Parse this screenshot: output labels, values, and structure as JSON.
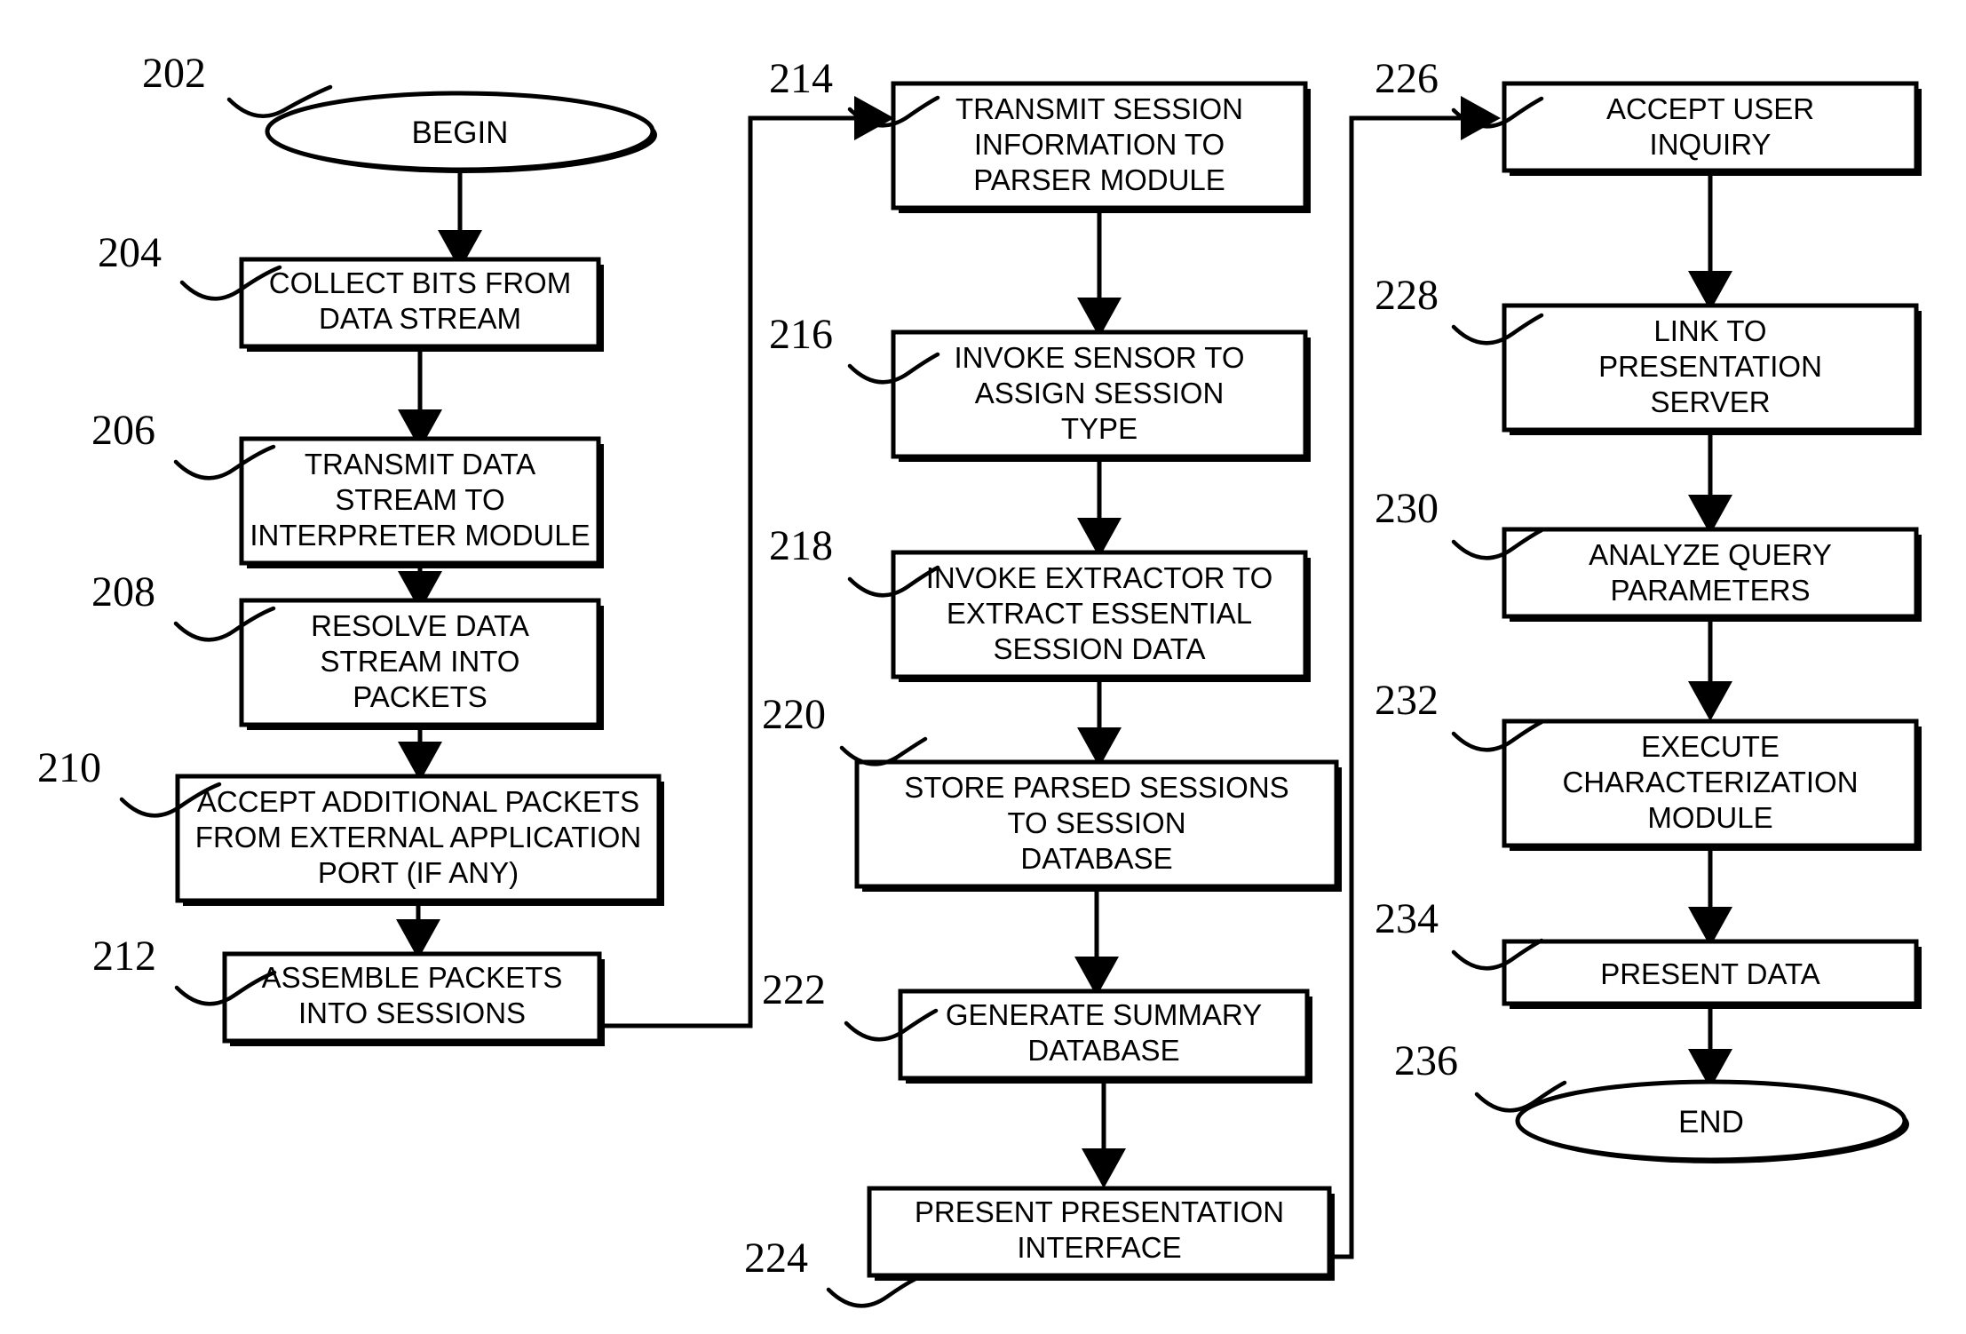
{
  "figure": {
    "type": "patent-flowchart",
    "background": "#ffffff",
    "ink": "#000000"
  },
  "nodes": [
    {
      "ref": "202",
      "shape": "oval",
      "lines": [
        "BEGIN"
      ]
    },
    {
      "ref": "204",
      "shape": "rect",
      "lines": [
        "COLLECT BITS FROM",
        "DATA STREAM"
      ]
    },
    {
      "ref": "206",
      "shape": "rect",
      "lines": [
        "TRANSMIT DATA",
        "STREAM TO",
        "INTERPRETER MODULE"
      ]
    },
    {
      "ref": "208",
      "shape": "rect",
      "lines": [
        "RESOLVE DATA",
        "STREAM INTO",
        "PACKETS"
      ]
    },
    {
      "ref": "210",
      "shape": "rect",
      "lines": [
        "ACCEPT ADDITIONAL PACKETS",
        "FROM EXTERNAL APPLICATION",
        "PORT (IF ANY)"
      ]
    },
    {
      "ref": "212",
      "shape": "rect",
      "lines": [
        "ASSEMBLE PACKETS",
        "INTO SESSIONS"
      ]
    },
    {
      "ref": "214",
      "shape": "rect",
      "lines": [
        "TRANSMIT SESSION",
        "INFORMATION TO",
        "PARSER MODULE"
      ]
    },
    {
      "ref": "216",
      "shape": "rect",
      "lines": [
        "INVOKE SENSOR TO",
        "ASSIGN SESSION",
        "TYPE"
      ]
    },
    {
      "ref": "218",
      "shape": "rect",
      "lines": [
        "INVOKE EXTRACTOR TO",
        "EXTRACT ESSENTIAL",
        "SESSION DATA"
      ]
    },
    {
      "ref": "220",
      "shape": "rect",
      "lines": [
        "STORE PARSED SESSIONS",
        "TO SESSION",
        "DATABASE"
      ]
    },
    {
      "ref": "222",
      "shape": "rect",
      "lines": [
        "GENERATE SUMMARY",
        "DATABASE"
      ]
    },
    {
      "ref": "224",
      "shape": "rect",
      "lines": [
        "PRESENT PRESENTATION",
        "INTERFACE"
      ]
    },
    {
      "ref": "226",
      "shape": "rect",
      "lines": [
        "ACCEPT USER",
        "INQUIRY"
      ]
    },
    {
      "ref": "228",
      "shape": "rect",
      "lines": [
        "LINK TO",
        "PRESENTATION",
        "SERVER"
      ]
    },
    {
      "ref": "230",
      "shape": "rect",
      "lines": [
        "ANALYZE QUERY",
        "PARAMETERS"
      ]
    },
    {
      "ref": "232",
      "shape": "rect",
      "lines": [
        "EXECUTE",
        "CHARACTERIZATION",
        "MODULE"
      ]
    },
    {
      "ref": "234",
      "shape": "rect",
      "lines": [
        "PRESENT DATA"
      ]
    },
    {
      "ref": "236",
      "shape": "oval",
      "lines": [
        "END"
      ]
    }
  ],
  "ref_labels": {
    "n202": "202",
    "n204": "204",
    "n206": "206",
    "n208": "208",
    "n210": "210",
    "n212": "212",
    "n214": "214",
    "n216": "216",
    "n218": "218",
    "n220": "220",
    "n222": "222",
    "n224": "224",
    "n226": "226",
    "n228": "228",
    "n230": "230",
    "n232": "232",
    "n234": "234",
    "n236": "236"
  },
  "labels": {
    "t202_1": "BEGIN",
    "t204_1": "COLLECT BITS FROM",
    "t204_2": "DATA STREAM",
    "t206_1": "TRANSMIT DATA",
    "t206_2": "STREAM TO",
    "t206_3": "INTERPRETER MODULE",
    "t208_1": "RESOLVE DATA",
    "t208_2": "STREAM INTO",
    "t208_3": "PACKETS",
    "t210_1": "ACCEPT ADDITIONAL PACKETS",
    "t210_2": "FROM EXTERNAL APPLICATION",
    "t210_3": "PORT (IF ANY)",
    "t212_1": "ASSEMBLE PACKETS",
    "t212_2": "INTO SESSIONS",
    "t214_1": "TRANSMIT SESSION",
    "t214_2": "INFORMATION TO",
    "t214_3": "PARSER MODULE",
    "t216_1": "INVOKE SENSOR TO",
    "t216_2": "ASSIGN SESSION",
    "t216_3": "TYPE",
    "t218_1": "INVOKE EXTRACTOR TO",
    "t218_2": "EXTRACT ESSENTIAL",
    "t218_3": "SESSION DATA",
    "t220_1": "STORE PARSED SESSIONS",
    "t220_2": "TO SESSION",
    "t220_3": "DATABASE",
    "t222_1": "GENERATE SUMMARY",
    "t222_2": "DATABASE",
    "t224_1": "PRESENT PRESENTATION",
    "t224_2": "INTERFACE",
    "t226_1": "ACCEPT USER",
    "t226_2": "INQUIRY",
    "t228_1": "LINK TO",
    "t228_2": "PRESENTATION",
    "t228_3": "SERVER",
    "t230_1": "ANALYZE QUERY",
    "t230_2": "PARAMETERS",
    "t232_1": "EXECUTE",
    "t232_2": "CHARACTERIZATION",
    "t232_3": "MODULE",
    "t234_1": "PRESENT DATA",
    "t236_1": "END"
  },
  "edges": [
    {
      "from": "202",
      "to": "204",
      "kind": "vertical-arrow"
    },
    {
      "from": "204",
      "to": "206",
      "kind": "vertical-arrow"
    },
    {
      "from": "206",
      "to": "208",
      "kind": "vertical-arrow"
    },
    {
      "from": "208",
      "to": "210",
      "kind": "vertical-arrow"
    },
    {
      "from": "210",
      "to": "212",
      "kind": "vertical-arrow"
    },
    {
      "from": "212",
      "to": "214",
      "kind": "routed-arrow"
    },
    {
      "from": "214",
      "to": "216",
      "kind": "vertical-arrow"
    },
    {
      "from": "216",
      "to": "218",
      "kind": "vertical-arrow"
    },
    {
      "from": "218",
      "to": "220",
      "kind": "vertical-arrow"
    },
    {
      "from": "220",
      "to": "222",
      "kind": "vertical-arrow"
    },
    {
      "from": "222",
      "to": "224",
      "kind": "vertical-arrow"
    },
    {
      "from": "224",
      "to": "226",
      "kind": "routed-arrow"
    },
    {
      "from": "226",
      "to": "228",
      "kind": "vertical-arrow"
    },
    {
      "from": "228",
      "to": "230",
      "kind": "vertical-arrow"
    },
    {
      "from": "230",
      "to": "232",
      "kind": "vertical-arrow"
    },
    {
      "from": "232",
      "to": "234",
      "kind": "vertical-arrow"
    },
    {
      "from": "234",
      "to": "236",
      "kind": "vertical-arrow"
    }
  ]
}
